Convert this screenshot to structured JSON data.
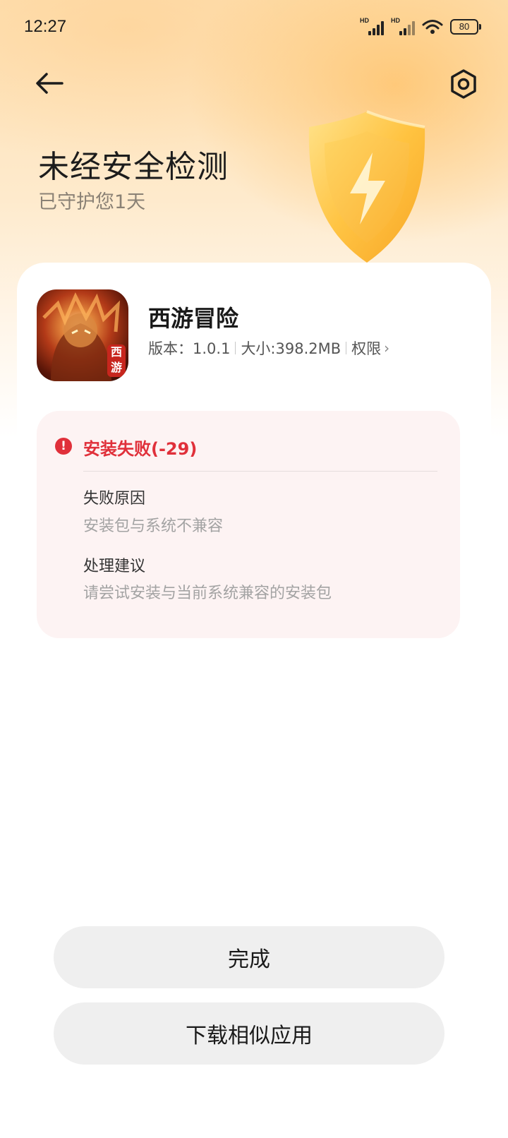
{
  "status_bar": {
    "time": "12:27",
    "signal_1_label": "HD",
    "signal_2_label": "HD",
    "battery": "80"
  },
  "header": {
    "title": "未经安全检测",
    "subtitle": "已守护您1天"
  },
  "app": {
    "name": "西游冒险",
    "version": "版本：1.0.1",
    "size": "大小:398.2MB",
    "permissions_label": "权限",
    "icon_stamp": "西游"
  },
  "error": {
    "title": "安装失败(-29)",
    "reason_heading": "失败原因",
    "reason_text": "安装包与系统不兼容",
    "suggestion_heading": "处理建议",
    "suggestion_text": "请尝试安装与当前系统兼容的安装包"
  },
  "buttons": {
    "done": "完成",
    "download_similar": "下载相似应用"
  },
  "colors": {
    "error_red": "#e0303a",
    "error_panel_bg": "#fdf3f3",
    "button_bg": "#efefef"
  }
}
